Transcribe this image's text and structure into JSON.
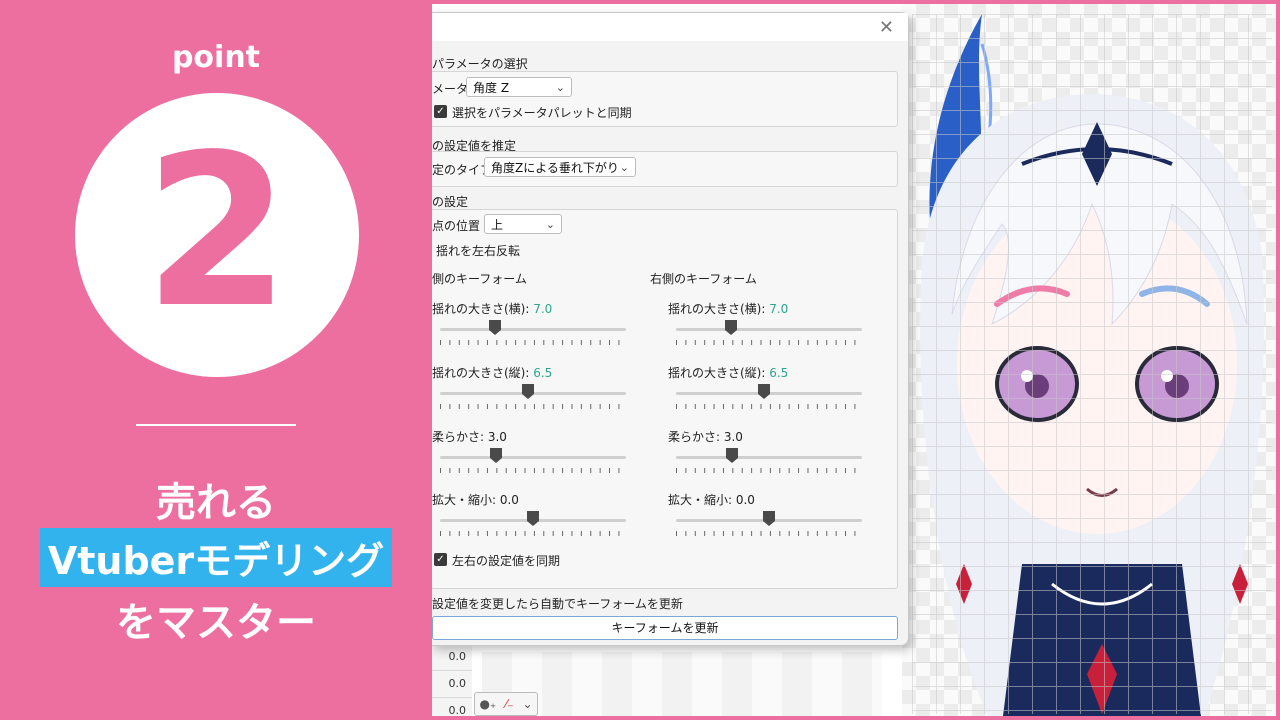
{
  "promo": {
    "point_label": "point",
    "number": "2",
    "line1": "売れる",
    "line2": "Vtuberモデリング",
    "line3": "をマスター"
  },
  "colors": {
    "brand_pink": "#ec6fa0",
    "highlight_blue": "#33b3ee",
    "value_green": "#2da58d"
  },
  "dialog": {
    "close_icon": "close-icon",
    "param_select": {
      "title": "パラメータの選択",
      "param_label": "メータ",
      "param_value": "角度 Z",
      "sync_label": "選択をパラメータパレットと同期",
      "sync_checked": true
    },
    "estimate": {
      "title": "の設定値を推定",
      "type_label": "定のタイプ",
      "type_value": "角度Zによる垂れ下がり"
    },
    "settings": {
      "title": "の設定",
      "pivot_label": "点の位置",
      "pivot_value": "上",
      "mirror_label": "揺れを左右反転",
      "left_title": "側のキーフォーム",
      "right_title": "右側のキーフォーム",
      "left": [
        {
          "label": "揺れの大きさ(横): ",
          "value": "7.0",
          "colored": true,
          "fraction": 0.28
        },
        {
          "label": "揺れの大きさ(縦): ",
          "value": "6.5",
          "colored": true,
          "fraction": 0.47
        },
        {
          "label": "柔らかさ: ",
          "value": "3.0",
          "colored": false,
          "fraction": 0.29
        },
        {
          "label": "拡大・縮小: ",
          "value": "0.0",
          "colored": false,
          "fraction": 0.5
        }
      ],
      "right": [
        {
          "label": "揺れの大きさ(横): ",
          "value": "7.0",
          "colored": true,
          "fraction": 0.28
        },
        {
          "label": "揺れの大きさ(縦): ",
          "value": "6.5",
          "colored": true,
          "fraction": 0.47
        },
        {
          "label": "柔らかさ: ",
          "value": "3.0",
          "colored": false,
          "fraction": 0.29
        },
        {
          "label": "拡大・縮小: ",
          "value": "0.0",
          "colored": false,
          "fraction": 0.5
        }
      ],
      "sync_lr_label": "左右の設定値を同期",
      "sync_lr_checked": true
    },
    "auto_update_label": "設定値を変更したら自動でキーフォームを更新",
    "update_button": "キーフォームを更新"
  },
  "background": {
    "values": [
      "0.0",
      "0.0",
      "0.0"
    ]
  }
}
